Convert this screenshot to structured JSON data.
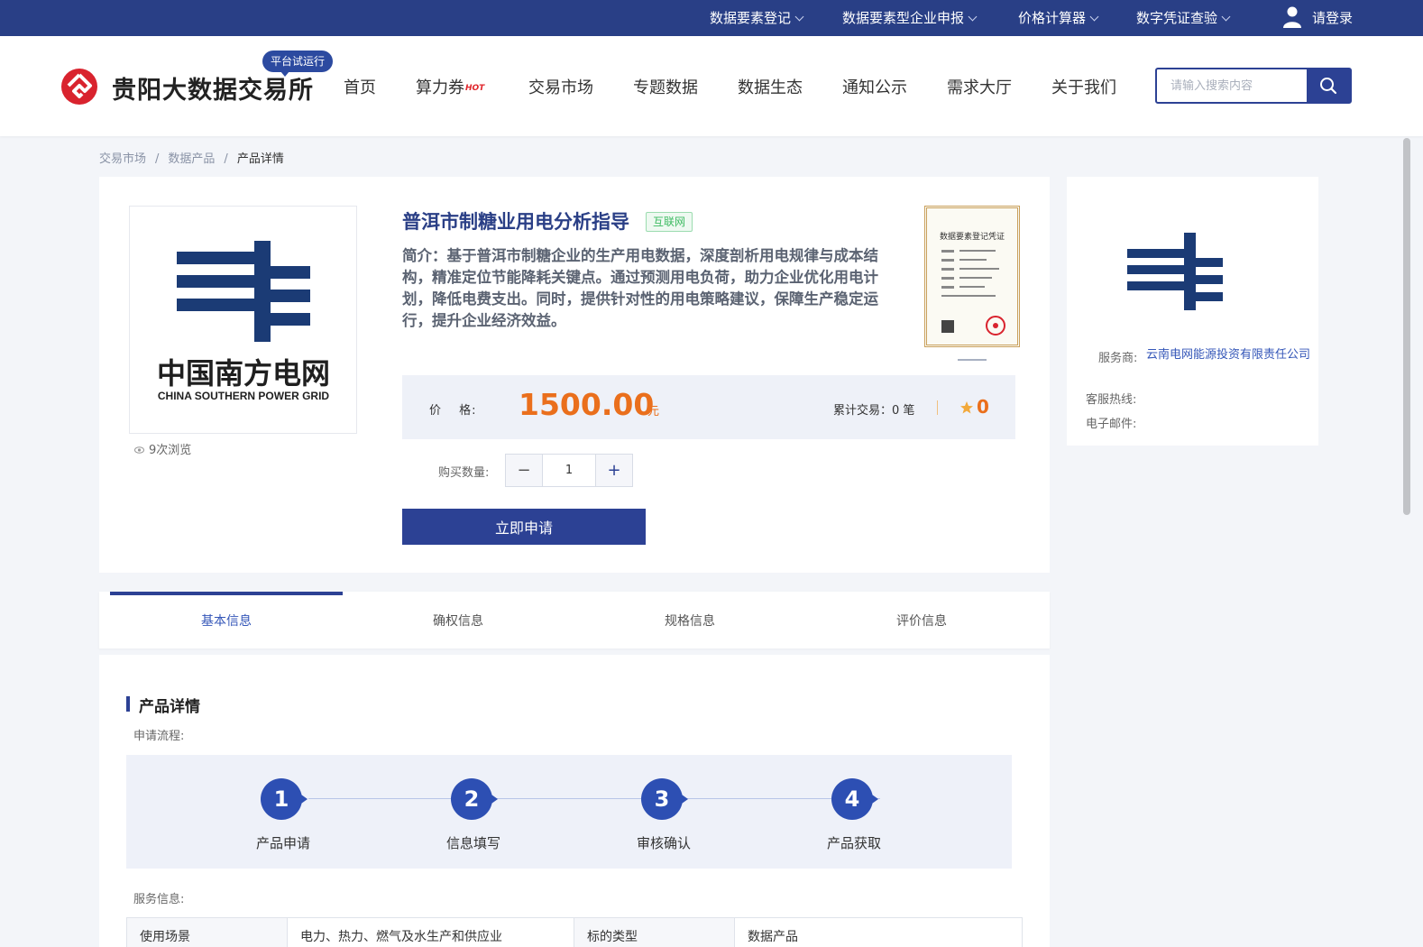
{
  "topbar": {
    "items": [
      {
        "label": "数据要素登记"
      },
      {
        "label": "数据要素型企业申报"
      },
      {
        "label": "价格计算器"
      },
      {
        "label": "数字凭证查验"
      }
    ],
    "login_label": "请登录"
  },
  "header": {
    "logo_text": "贵阳大数据交易所",
    "trial_badge": "平台试运行",
    "nav": [
      {
        "label": "首页"
      },
      {
        "label": "算力券"
      },
      {
        "label": "交易市场"
      },
      {
        "label": "专题数据"
      },
      {
        "label": "数据生态"
      },
      {
        "label": "通知公示"
      },
      {
        "label": "需求大厅"
      },
      {
        "label": "关于我们"
      }
    ],
    "hot_tag": "HOT",
    "search_placeholder": "请输入搜索内容"
  },
  "breadcrumb": {
    "items": [
      "交易市场",
      "数据产品"
    ],
    "current": "产品详情",
    "separator": "/"
  },
  "product": {
    "image": {
      "cn": "中国南方电网",
      "en": "CHINA SOUTHERN POWER GRID"
    },
    "views": "9次浏览",
    "title": "普洱市制糖业用电分析指导",
    "badge": "互联网",
    "description": "简介：基于普洱市制糖企业的生产用电数据，深度剖析用电规律与成本结构，精准定位节能降耗关键点。通过预测用电负荷，助力企业优化用电计划，降低电费支出。同时，提供针对性的用电策略建议，保障生产稳定运行，提升企业经济效益。",
    "certificate_title": "数据要素登记凭证",
    "price_label": "价　 格:",
    "price": "1500.00",
    "price_unit": "元",
    "trade_label": "累计交易：",
    "trade_count": "0 笔",
    "rating": "0",
    "qty_label": "购买数量:",
    "qty_minus": "−",
    "qty_value": "1",
    "qty_plus": "+",
    "apply_label": "立即申请"
  },
  "provider": {
    "service_label": "服务商:",
    "service_name": "云南电网能源投资有限责任公司",
    "hotline_label": "客服热线:",
    "email_label": "电子邮件:"
  },
  "tabs": [
    {
      "label": "基本信息"
    },
    {
      "label": "确权信息"
    },
    {
      "label": "规格信息"
    },
    {
      "label": "评价信息"
    }
  ],
  "details": {
    "title": "产品详情",
    "process_label": "申请流程:",
    "steps": [
      {
        "num": "1",
        "label": "产品申请"
      },
      {
        "num": "2",
        "label": "信息填写"
      },
      {
        "num": "3",
        "label": "审核确认"
      },
      {
        "num": "4",
        "label": "产品获取"
      }
    ],
    "service_info_label": "服务信息:",
    "table": {
      "k1": "使用场景",
      "v1": "电力、热力、燃气及水生产和供应业",
      "k2": "标的类型",
      "v2": "数据产品"
    }
  },
  "colors": {
    "brand": "#2c4194",
    "topbar": "#293f86",
    "price": "#ea6f1c",
    "grid_logo": "#1b3b75"
  }
}
